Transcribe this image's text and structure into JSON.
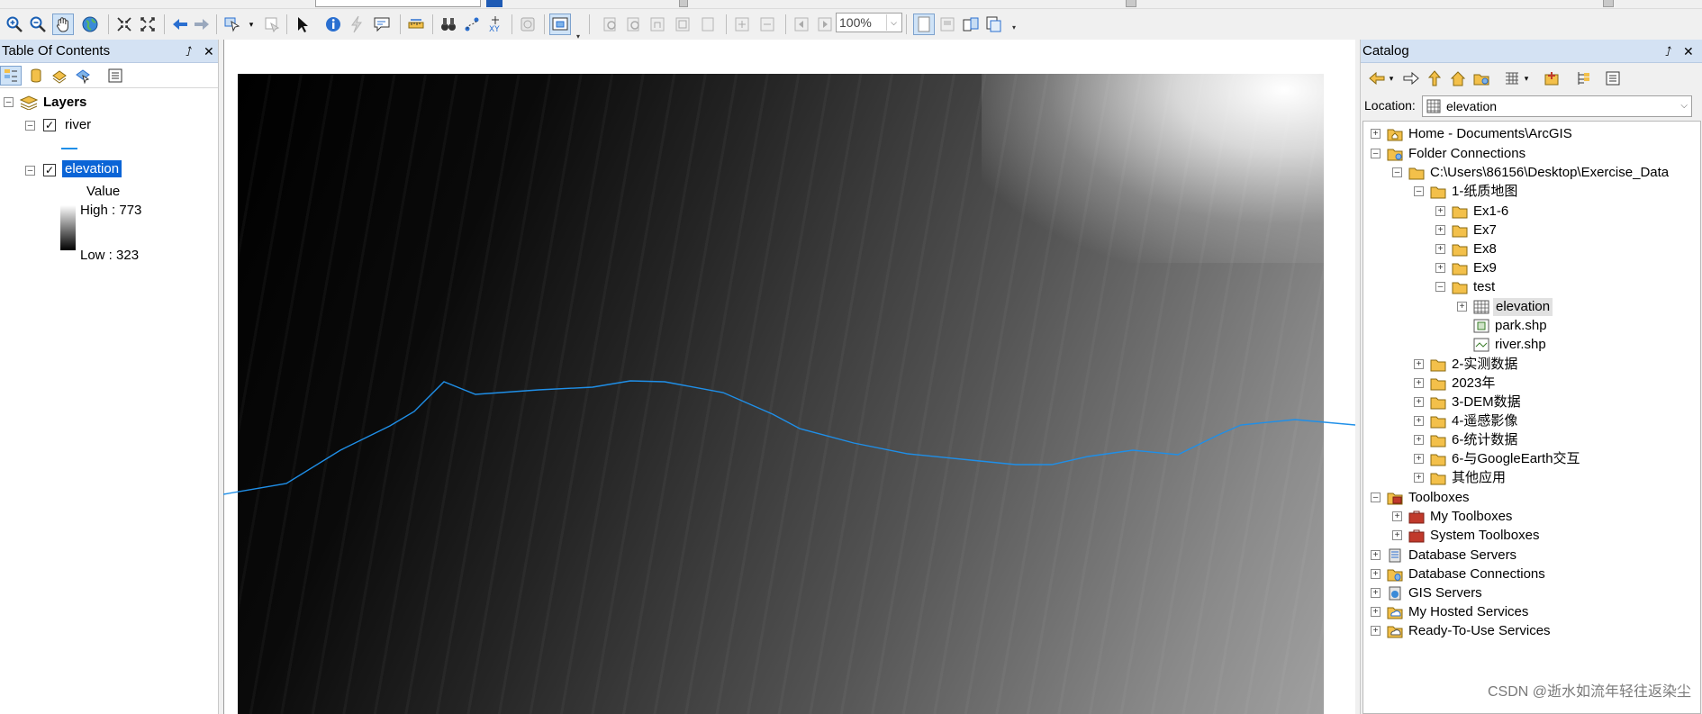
{
  "toolbar": {
    "zoom_level": "100%"
  },
  "toc": {
    "title": "Table Of Contents",
    "pin": "⭜",
    "close": "✕",
    "layers_label": "Layers",
    "layer_river": "river",
    "layer_elevation": "elevation",
    "legend_value": "Value",
    "legend_high": "High : 773",
    "legend_low": "Low : 323"
  },
  "catalog": {
    "title": "Catalog",
    "location_label": "Location:",
    "location_value": "elevation",
    "tree": {
      "home": "Home - Documents\\ArcGIS",
      "folder_connections": "Folder Connections",
      "path": "C:\\Users\\86156\\Desktop\\Exercise_Data",
      "f1": "1-纸质地图",
      "ex16": "Ex1-6",
      "ex7": "Ex7",
      "ex8": "Ex8",
      "ex9": "Ex9",
      "test": "test",
      "elevation": "elevation",
      "park": "park.shp",
      "river": "river.shp",
      "f2": "2-实测数据",
      "f2023": "2023年",
      "f3": "3-DEM数据",
      "f4": "4-遥感影像",
      "f6a": "6-统计数据",
      "f6b": "6-与GoogleEarth交互",
      "fother": "其他应用",
      "toolboxes": "Toolboxes",
      "my_toolboxes": "My Toolboxes",
      "system_toolboxes": "System Toolboxes",
      "db_servers": "Database Servers",
      "db_connections": "Database Connections",
      "gis_servers": "GIS Servers",
      "hosted_services": "My Hosted Services",
      "ready_services": "Ready-To-Use Services"
    }
  },
  "watermark": "CSDN @逝水如流年轻往返染尘",
  "colors": {
    "river": "#1f8fe8",
    "selection": "#0a64d6",
    "panel_title": "#d4e2f3"
  }
}
